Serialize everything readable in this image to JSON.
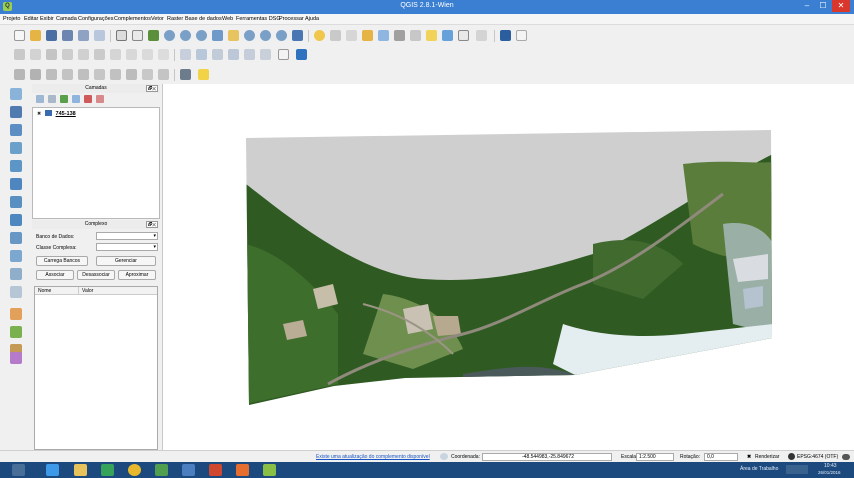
{
  "window": {
    "title": "QGIS 2.8.1-Wien",
    "logo": "qgis-logo",
    "min": "–",
    "max": "☐",
    "close": "✕"
  },
  "menu": [
    "Projeto",
    "Editar",
    "Exibir",
    "Camada",
    "Configurações",
    "Complementos",
    "Vetor",
    "Raster",
    "Base de dados",
    "Web",
    "Ferramentas DSG",
    "Processar",
    "Ajuda"
  ],
  "layers_panel": {
    "title": "Camadas",
    "title_buttons": "🗗✕",
    "layer": {
      "name": "745-138",
      "checked": true,
      "checkbox": "✖"
    }
  },
  "complexos_panel": {
    "title": "Complexo",
    "title_buttons": "🗗✕",
    "db_label": "Banco de Dados:",
    "class_label": "Classe Complexa:",
    "dropdown_arrow": "▾",
    "buttons": {
      "load": "Carrega Bancos",
      "manage": "Gerenciar",
      "associate": "Associar",
      "disassociate": "Desassociar",
      "zoom": "Aproximar"
    },
    "columns": [
      "Nome",
      "Valor"
    ]
  },
  "status": {
    "update_link": "Existe uma atualização do complemento disponível",
    "coord_label": "Coordenada:",
    "coord_value": "-48.544983,-25.849672",
    "scale_label": "Escala",
    "scale_value": "1:2.500",
    "rotation_label": "Rotação:",
    "rotation_value": "0,0",
    "render_label": "Renderizar",
    "render_check": "✖",
    "crs": "EPSG:4674 (OTF)"
  },
  "taskbar": {
    "desktop_label": "Área de Trabalho",
    "time": "10:43",
    "date": "26/01/2016"
  },
  "colors": {
    "titlebar": "#3a7fd1",
    "close": "#d9362c",
    "taskbar": "#1c4a7e",
    "raster_nodata": "#cfcfcf",
    "vegetation": "#2f5b22"
  }
}
